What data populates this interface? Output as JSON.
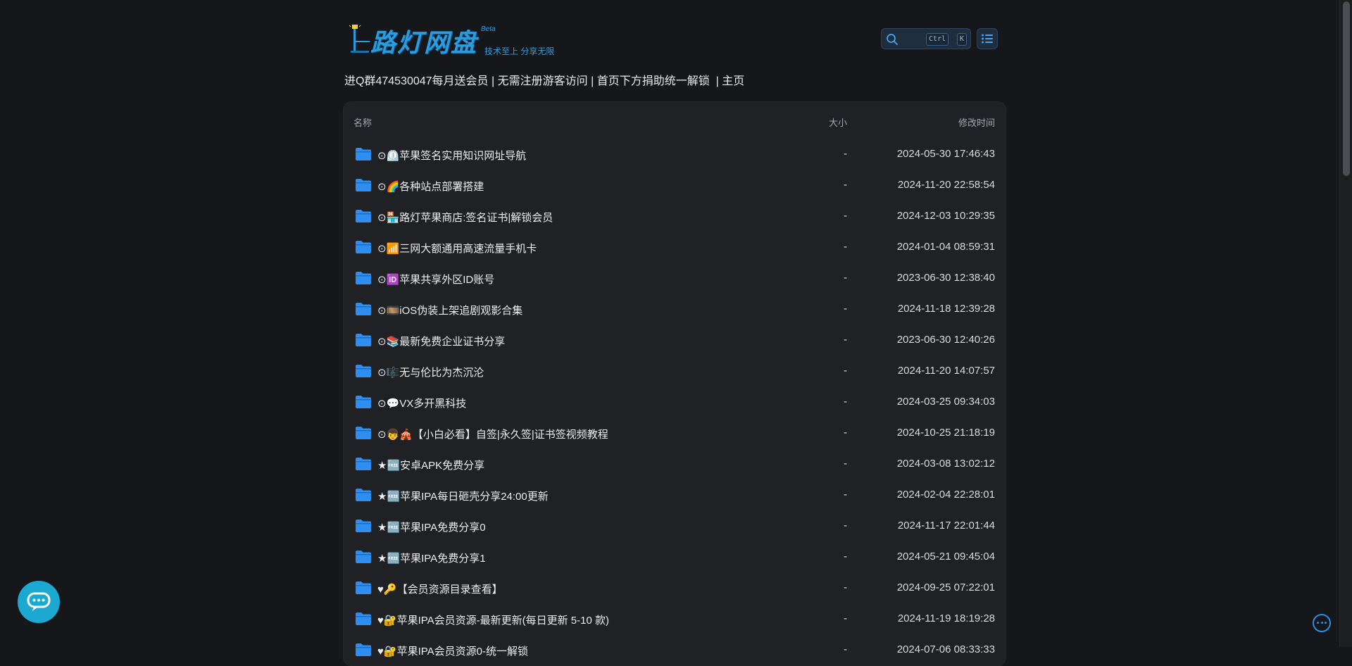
{
  "brand": {
    "logo_text": "路灯网盘",
    "beta": "Beta",
    "slogan": "技术至上 分享无限"
  },
  "search": {
    "kbd_ctrl": "Ctrl",
    "kbd_k": "K"
  },
  "notice": {
    "items": [
      "进Q群474530047每月送会员",
      "无需注册游客访问",
      "首页下方捐助统一解锁",
      "主页"
    ]
  },
  "table": {
    "headers": {
      "name": "名称",
      "size": "大小",
      "modified": "修改时间"
    },
    "rows": [
      {
        "name": "⊙⏲️苹果签名实用知识网址导航",
        "size": "-",
        "modified": "2024-05-30 17:46:43"
      },
      {
        "name": "⊙🌈各种站点部署搭建",
        "size": "-",
        "modified": "2024-11-20 22:58:54"
      },
      {
        "name": "⊙🏪路灯苹果商店:签名证书|解锁会员",
        "size": "-",
        "modified": "2024-12-03 10:29:35"
      },
      {
        "name": "⊙📶三网大额通用高速流量手机卡",
        "size": "-",
        "modified": "2024-01-04 08:59:31"
      },
      {
        "name": "⊙🆔苹果共享外区ID账号",
        "size": "-",
        "modified": "2023-06-30 12:38:40"
      },
      {
        "name": "⊙🎞️iOS伪装上架追剧观影合集",
        "size": "-",
        "modified": "2024-11-18 12:39:28"
      },
      {
        "name": "⊙📚最新免费企业证书分享",
        "size": "-",
        "modified": "2023-06-30 12:40:26"
      },
      {
        "name": "⊙🎼无与伦比为杰沉沦",
        "size": "-",
        "modified": "2024-11-20 14:07:57"
      },
      {
        "name": "⊙💬VX多开黑科技",
        "size": "-",
        "modified": "2024-03-25 09:34:03"
      },
      {
        "name": "⊙👦🎪【小白必看】自签|永久签|证书签视频教程",
        "size": "-",
        "modified": "2024-10-25 21:18:19"
      },
      {
        "name": "★🆓安卓APK免费分享",
        "size": "-",
        "modified": "2024-03-08 13:02:12"
      },
      {
        "name": "★🆓苹果IPA每日砸壳分享24:00更新",
        "size": "-",
        "modified": "2024-02-04 22:28:01"
      },
      {
        "name": "★🆓苹果IPA免费分享0",
        "size": "-",
        "modified": "2024-11-17 22:01:44"
      },
      {
        "name": "★🆓苹果IPA免费分享1",
        "size": "-",
        "modified": "2024-05-21 09:45:04"
      },
      {
        "name": "♥🔑【会员资源目录查看】",
        "size": "-",
        "modified": "2024-09-25 07:22:01"
      },
      {
        "name": "♥🔐苹果IPA会员资源-最新更新(每日更新 5-10 款)",
        "size": "-",
        "modified": "2024-11-19 18:19:28"
      },
      {
        "name": "♥🔐苹果IPA会员资源0-统一解锁",
        "size": "-",
        "modified": "2024-07-06 08:33:33"
      }
    ]
  },
  "colors": {
    "background": "#15171a",
    "panel": "#1f2124",
    "folder": "#2f8ff0",
    "accent": "#2b9bdf",
    "chat": "#1ba9d2"
  }
}
